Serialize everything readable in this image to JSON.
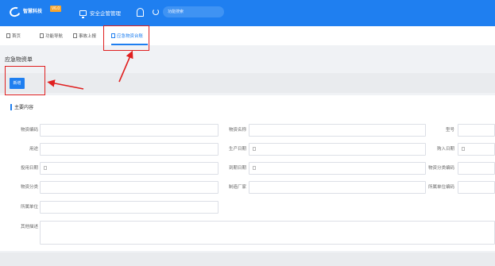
{
  "header": {
    "logo_text": "智慧科技",
    "version_badge": "V6.0",
    "nav_title": "安全企管管理",
    "search_placeholder": "功能搜索",
    "icons": [
      "logo-icon",
      "monitor-icon",
      "bell-icon",
      "refresh-icon"
    ],
    "bg_color": "#1f7ff0"
  },
  "tabs": [
    {
      "label": "首页",
      "active": false
    },
    {
      "label": "功能导航",
      "active": false
    },
    {
      "label": "事故上报",
      "active": false
    },
    {
      "label": "应急物资台账",
      "active": true
    }
  ],
  "page": {
    "title": "应急物资单",
    "add_button": "新增",
    "section_title": "主要内容"
  },
  "form": {
    "row1": {
      "code": "物资编码",
      "name": "物资名称",
      "model": "型号"
    },
    "row2": {
      "use": "用途",
      "prod_date": "生产日期",
      "buy_date": "购入日期"
    },
    "row3": {
      "enable_date": "投用日期",
      "expire_date": "到期日期",
      "class_code": "物资分类编码"
    },
    "row4": {
      "category": "物资分类",
      "maker": "制造厂家",
      "dept_code": "所属单位编码"
    },
    "row5": {
      "dept": "所属单位"
    },
    "row6": {
      "other": "其他描述"
    }
  },
  "annotation_color": "#e02020"
}
